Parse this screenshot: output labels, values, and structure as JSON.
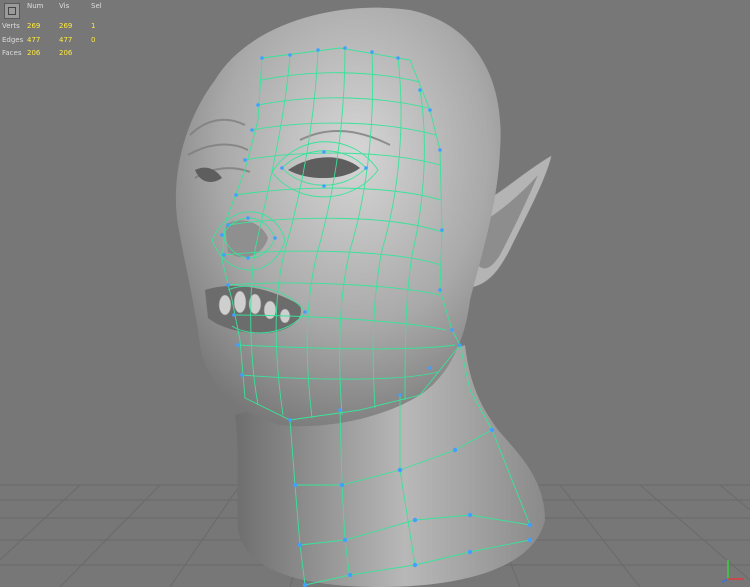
{
  "hud": {
    "columns": [
      "Num",
      "Vis",
      "Sel"
    ],
    "rows": [
      {
        "label": "Verts",
        "num": "269",
        "vis": "269",
        "sel": "1"
      },
      {
        "label": "Edges",
        "num": "477",
        "vis": "477",
        "sel": "0"
      },
      {
        "label": "Faces",
        "num": "206",
        "vis": "206",
        "sel": ""
      }
    ]
  },
  "icons": {
    "mode": "select-mode-icon",
    "gizmo": "axis-gizmo-icon"
  },
  "colors": {
    "viewport_bg": "#767676",
    "grid_line": "#6a6a6a",
    "wire": "#39e39a",
    "vertex": "#3fa0ff",
    "hud_text": "#dddddd",
    "hud_value": "#ffea3a"
  }
}
